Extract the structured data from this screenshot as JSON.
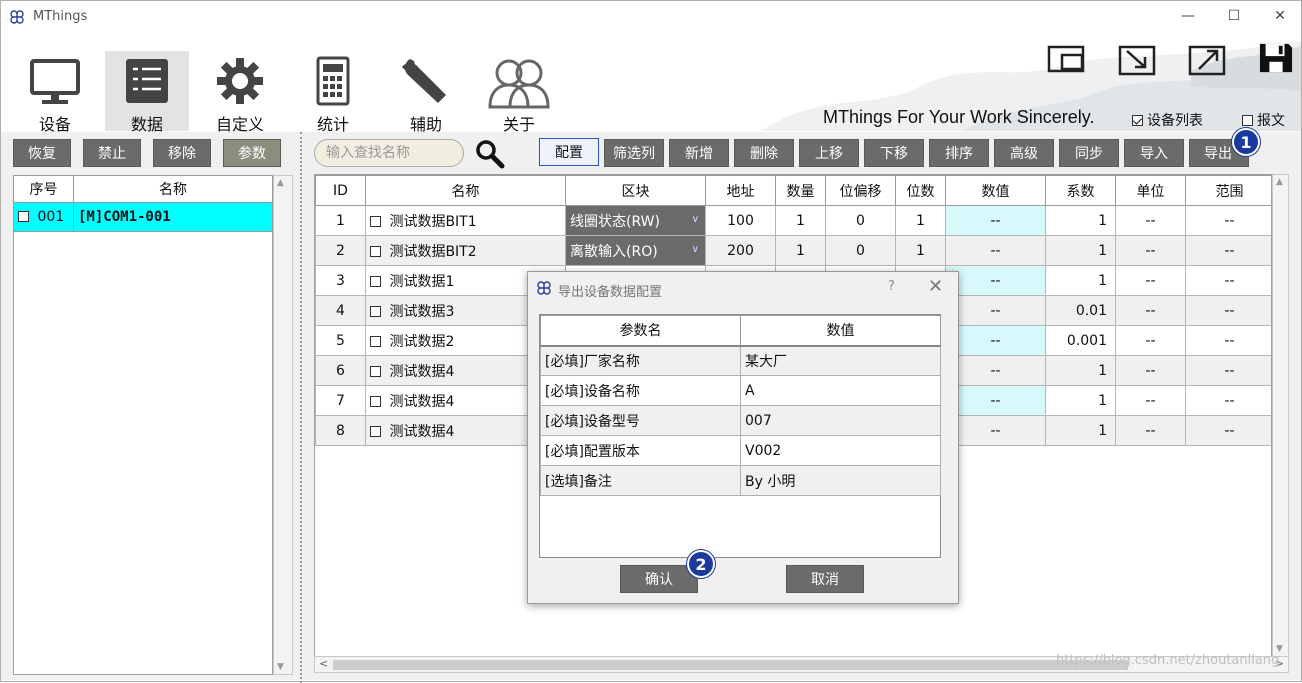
{
  "window": {
    "title": "MThings",
    "minimize": "—",
    "maximize": "☐",
    "close": "✕"
  },
  "nav": [
    {
      "label": "设备",
      "icon": "monitor-icon"
    },
    {
      "label": "数据",
      "icon": "data-list-icon"
    },
    {
      "label": "自定义",
      "icon": "gear-icon"
    },
    {
      "label": "统计",
      "icon": "calculator-icon"
    },
    {
      "label": "辅助",
      "icon": "wrench-icon"
    },
    {
      "label": "关于",
      "icon": "users-icon"
    }
  ],
  "slogan": "MThings For Your Work Sincerely.",
  "options": {
    "device_list": "设备列表",
    "device_list_checked": true,
    "packet": "报文",
    "packet_checked": false
  },
  "left_toolbar": [
    "恢复",
    "禁止",
    "移除",
    "参数"
  ],
  "search": {
    "placeholder": "输入查找名称"
  },
  "toolbar": [
    "配置",
    "筛选列",
    "新增",
    "删除",
    "上移",
    "下移",
    "排序",
    "高级",
    "同步",
    "导入",
    "导出"
  ],
  "device_table": {
    "headers": [
      "序号",
      "名称"
    ],
    "rows": [
      {
        "index": "001",
        "name": "[M]COM1-001"
      }
    ]
  },
  "data_table": {
    "headers": [
      "ID",
      "名称",
      "区块",
      "地址",
      "数量",
      "位偏移",
      "位数",
      "数值",
      "系数",
      "单位",
      "范围"
    ],
    "rows": [
      {
        "id": "1",
        "name": "测试数据BIT1",
        "block": "线圈状态(RW)",
        "addr": "100",
        "qty": "1",
        "offset": "0",
        "bits": "1",
        "value": "--",
        "factor": "1",
        "unit": "--",
        "range": "--"
      },
      {
        "id": "2",
        "name": "测试数据BIT2",
        "block": "离散输入(RO)",
        "addr": "200",
        "qty": "1",
        "offset": "0",
        "bits": "1",
        "value": "--",
        "factor": "1",
        "unit": "--",
        "range": "--"
      },
      {
        "id": "3",
        "name": "测试数据1",
        "block": "",
        "addr": "",
        "qty": "",
        "offset": "",
        "bits": "",
        "value": "--",
        "factor": "1",
        "unit": "--",
        "range": "--"
      },
      {
        "id": "4",
        "name": "测试数据3",
        "block": "",
        "addr": "",
        "qty": "",
        "offset": "",
        "bits": "",
        "value": "--",
        "factor": "0.01",
        "unit": "--",
        "range": "--"
      },
      {
        "id": "5",
        "name": "测试数据2",
        "block": "",
        "addr": "",
        "qty": "",
        "offset": "",
        "bits": "",
        "value": "--",
        "factor": "0.001",
        "unit": "--",
        "range": "--"
      },
      {
        "id": "6",
        "name": "测试数据4",
        "block": "",
        "addr": "",
        "qty": "",
        "offset": "",
        "bits": "",
        "value": "--",
        "factor": "1",
        "unit": "--",
        "range": "--"
      },
      {
        "id": "7",
        "name": "测试数据4",
        "block": "",
        "addr": "",
        "qty": "",
        "offset": "",
        "bits": "",
        "value": "--",
        "factor": "1",
        "unit": "--",
        "range": "--"
      },
      {
        "id": "8",
        "name": "测试数据4",
        "block": "",
        "addr": "",
        "qty": "",
        "offset": "",
        "bits": "",
        "value": "--",
        "factor": "1",
        "unit": "--",
        "range": "--"
      }
    ]
  },
  "dialog": {
    "title": "导出设备数据配置",
    "help": "?",
    "close": "✕",
    "headers": [
      "参数名",
      "数值"
    ],
    "rows": [
      {
        "param": "[必填]厂家名称",
        "value": "某大厂"
      },
      {
        "param": "[必填]设备名称",
        "value": "A"
      },
      {
        "param": "[必填]设备型号",
        "value": "007"
      },
      {
        "param": "[必填]配置版本",
        "value": "V002"
      },
      {
        "param": "[选填]备注",
        "value": "By 小明"
      }
    ],
    "confirm": "确认",
    "cancel": "取消"
  },
  "badges": [
    "1",
    "2"
  ],
  "watermark": "https://blog.csdn.net/zhoutanliang"
}
